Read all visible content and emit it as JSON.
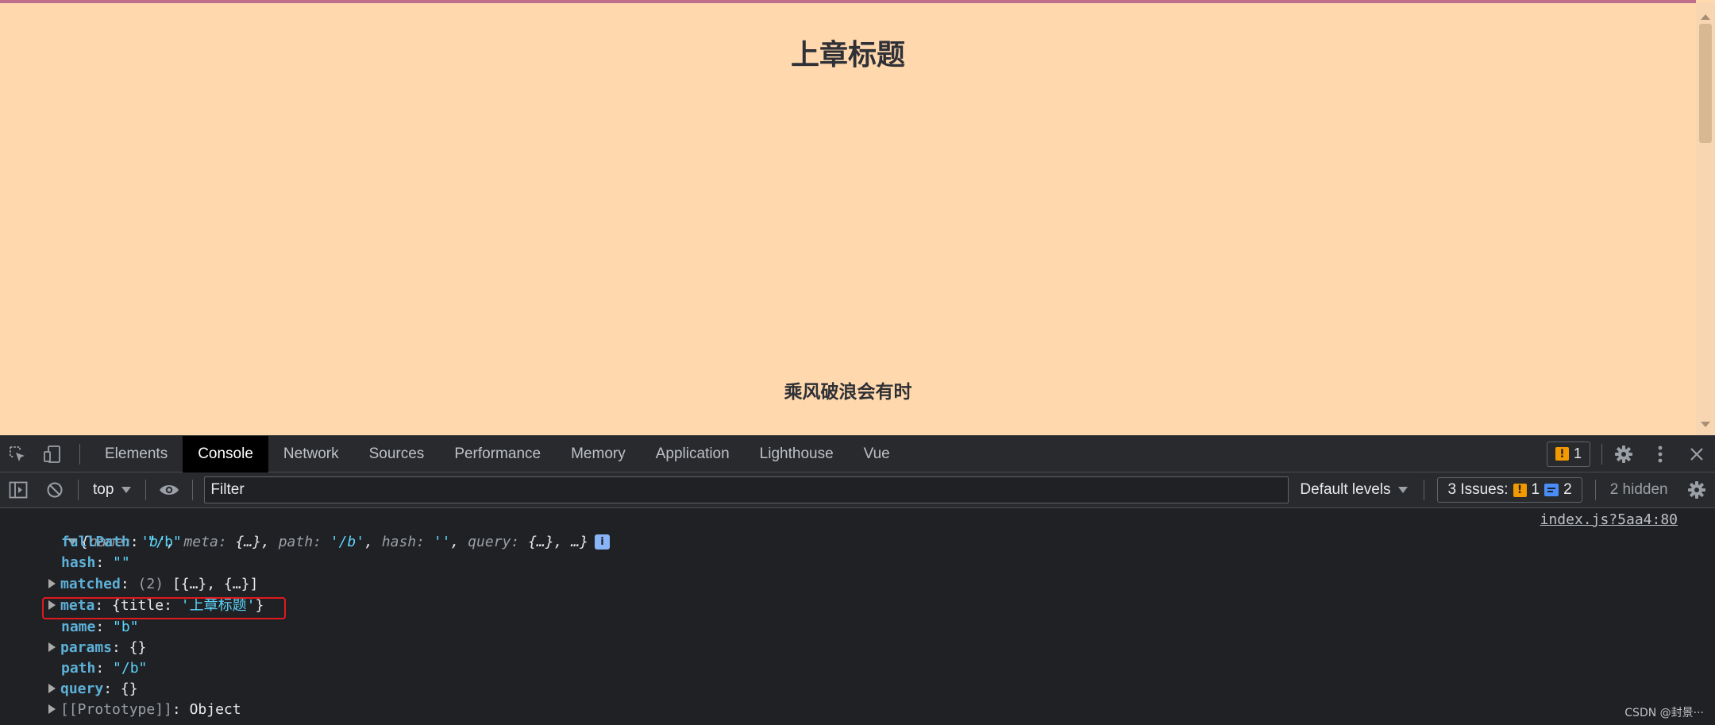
{
  "page": {
    "heading": "上章标题",
    "subheading": "乘风破浪会有时"
  },
  "devtools": {
    "tabs": [
      {
        "label": "Elements"
      },
      {
        "label": "Console"
      },
      {
        "label": "Network"
      },
      {
        "label": "Sources"
      },
      {
        "label": "Performance"
      },
      {
        "label": "Memory"
      },
      {
        "label": "Application"
      },
      {
        "label": "Lighthouse"
      },
      {
        "label": "Vue"
      }
    ],
    "active_tab": "Console",
    "issues_badge_count": "1"
  },
  "console_toolbar": {
    "context": "top",
    "filter_placeholder": "Filter",
    "levels": "Default levels",
    "issues_label": "3 Issues:",
    "issues_warning_count": "1",
    "issues_info_count": "2",
    "hidden": "2 hidden"
  },
  "console_output": {
    "source_link": "index.js?5aa4:80",
    "summary": {
      "open": "{",
      "name_key": "name",
      "name_val": "'b'",
      "meta_key": "meta",
      "meta_val": "{…}",
      "path_key": "path",
      "path_val": "'/b'",
      "hash_key": "hash",
      "hash_val": "''",
      "query_key": "query",
      "query_val": "{…}",
      "rest": "…}",
      "info_badge": "i"
    },
    "props": {
      "fullPath_key": "fullPath",
      "fullPath_val": "\"/b\"",
      "hash_key": "hash",
      "hash_val": "\"\"",
      "matched_key": "matched",
      "matched_count": "(2)",
      "matched_val": "[{…}, {…}]",
      "meta_key": "meta",
      "meta_open": "{title: ",
      "meta_title": "'上章标题'",
      "meta_close": "}",
      "name_key": "name",
      "name_val": "\"b\"",
      "params_key": "params",
      "params_val": "{}",
      "path_key": "path",
      "path_val": "\"/b\"",
      "query_key": "query",
      "query_val": "{}",
      "proto_key": "[[Prototype]]",
      "proto_val": "Object"
    }
  },
  "watermark": "CSDN @封景···"
}
